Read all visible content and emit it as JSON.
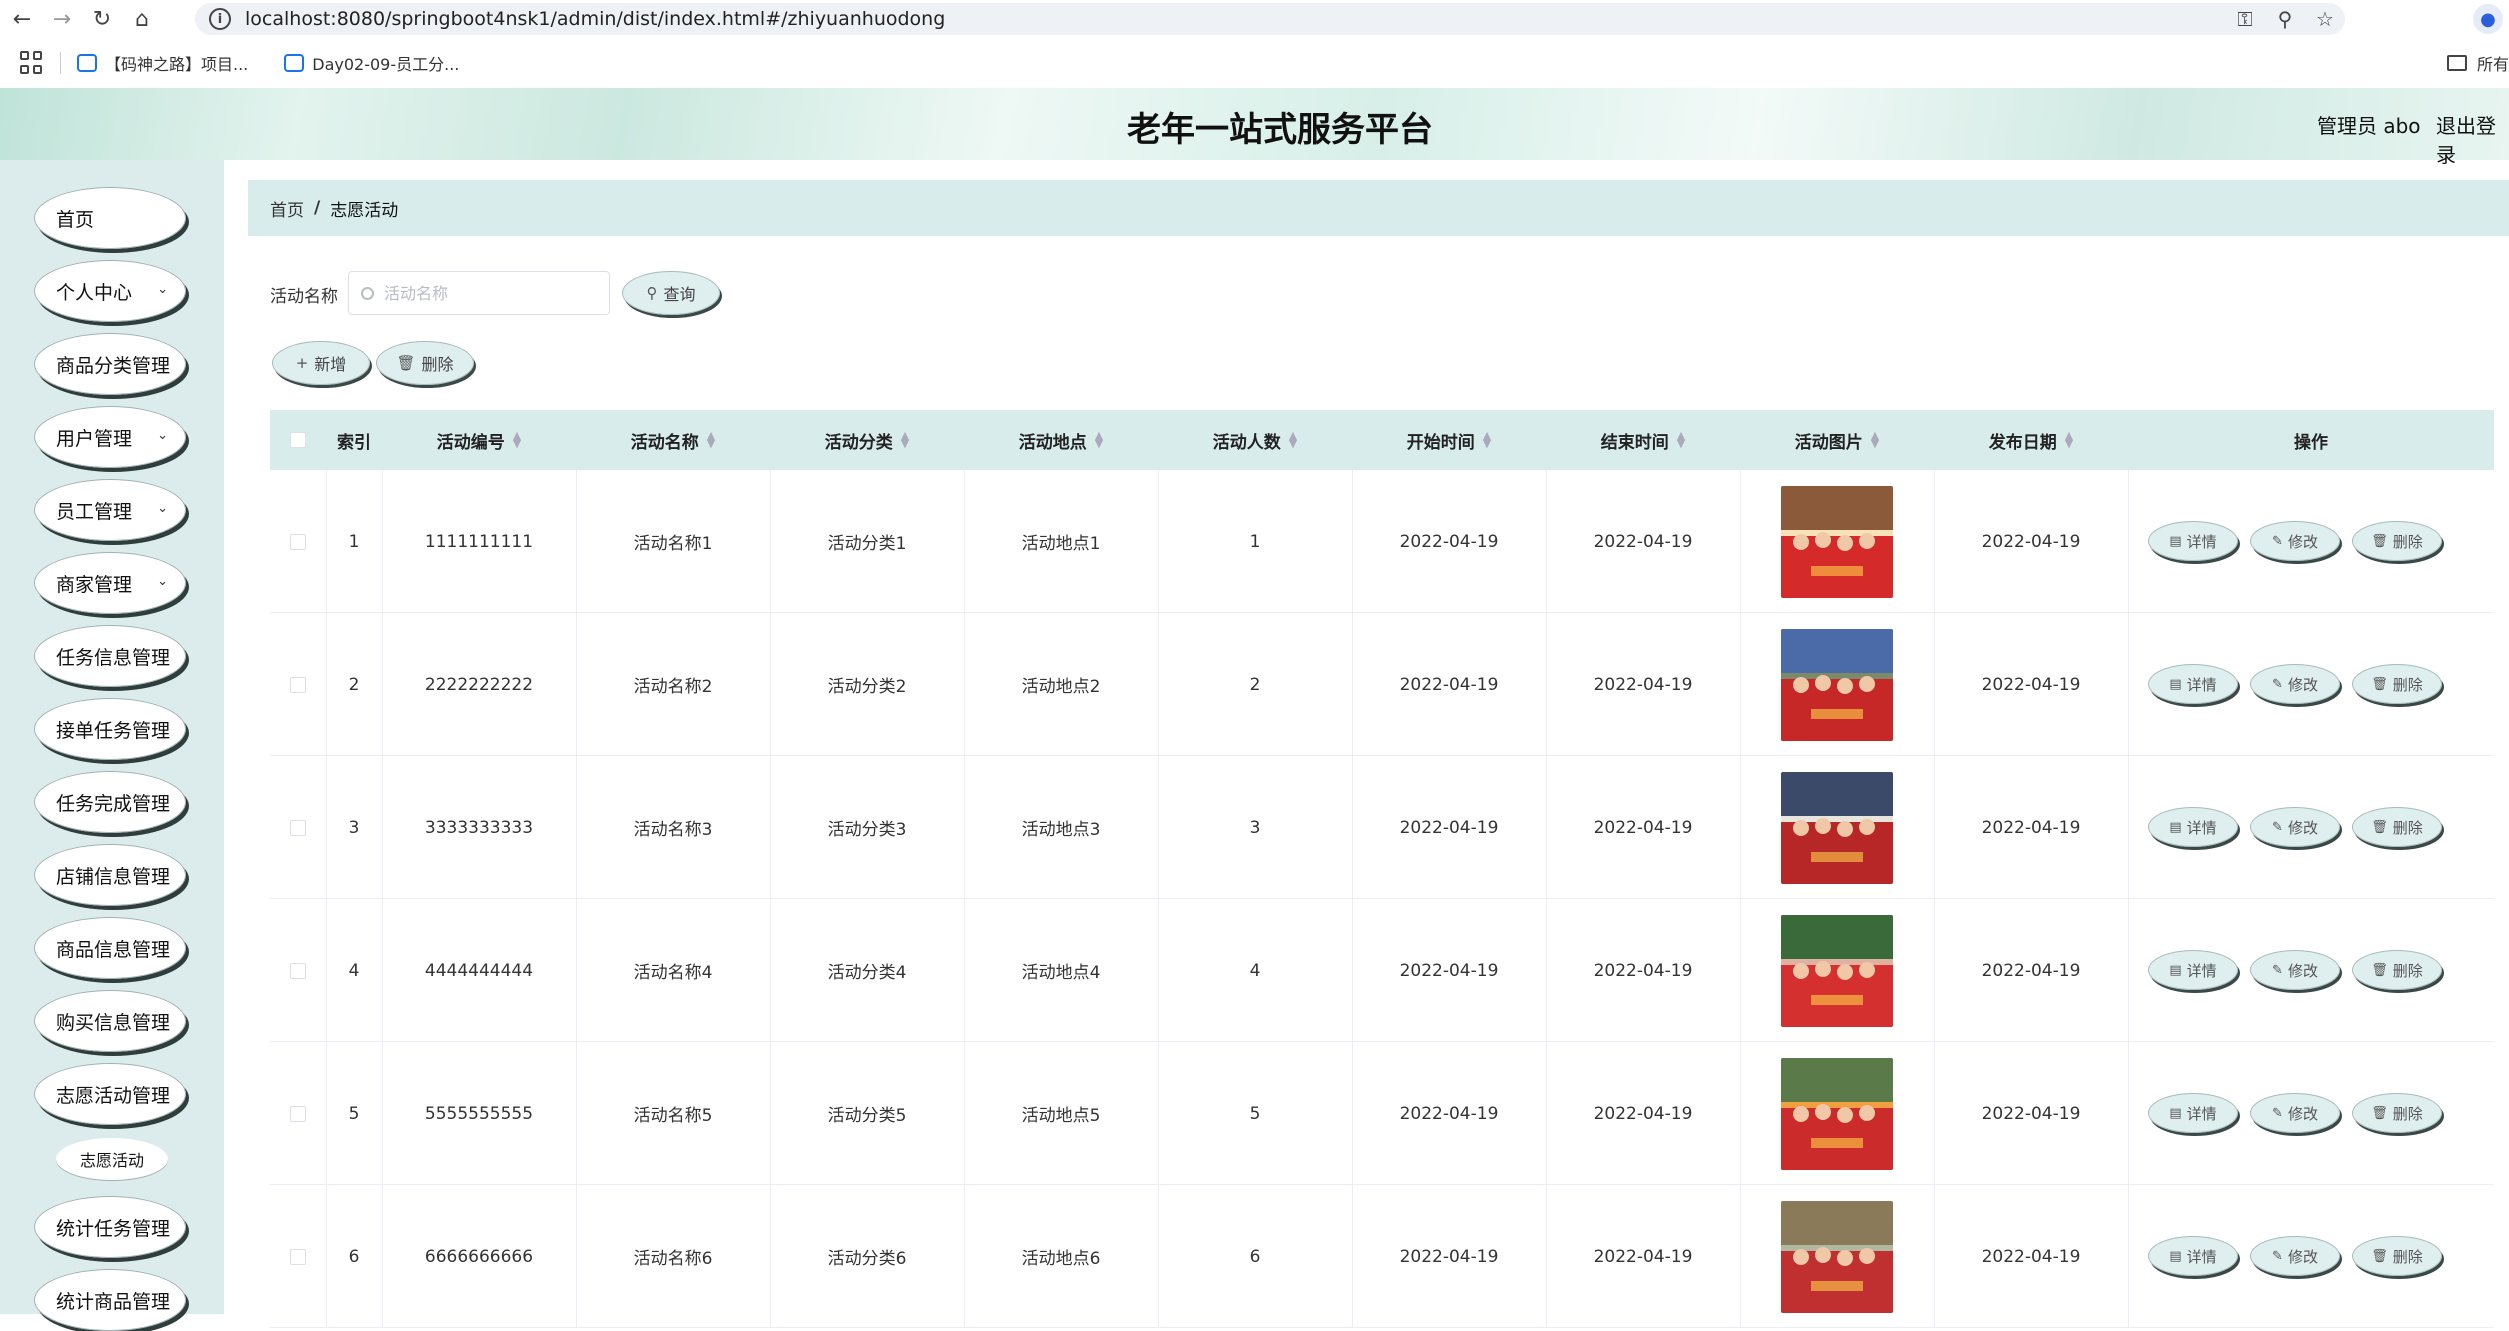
{
  "browser": {
    "url": "localhost:8080/springboot4nsk1/admin/dist/index.html#/zhiyuanhuodong",
    "bookmarks": [
      {
        "label": "【码神之路】项目..."
      },
      {
        "label": "Day02-09-员工分..."
      }
    ],
    "bookmarks_right": "所有"
  },
  "header": {
    "title": "老年一站式服务平台",
    "admin": "管理员 abo",
    "logout": "退出登录"
  },
  "sidebar": {
    "items": [
      {
        "label": "首页"
      },
      {
        "label": "个人中心"
      },
      {
        "label": "商品分类管理"
      },
      {
        "label": "用户管理"
      },
      {
        "label": "员工管理"
      },
      {
        "label": "商家管理"
      },
      {
        "label": "任务信息管理"
      },
      {
        "label": "接单任务管理"
      },
      {
        "label": "任务完成管理"
      },
      {
        "label": "店铺信息管理"
      },
      {
        "label": "商品信息管理"
      },
      {
        "label": "购买信息管理"
      },
      {
        "label": "志愿活动管理"
      },
      {
        "label": "统计任务管理"
      },
      {
        "label": "统计商品管理"
      }
    ],
    "submenu": "志愿活动"
  },
  "breadcrumb": {
    "home": "首页",
    "sep": "/",
    "current": "志愿活动"
  },
  "search": {
    "label": "活动名称",
    "placeholder": "活动名称",
    "button": "查询"
  },
  "toolbar": {
    "add": "新增",
    "delete": "删除"
  },
  "table": {
    "columns": [
      "索引",
      "活动编号",
      "活动名称",
      "活动分类",
      "活动地点",
      "活动人数",
      "开始时间",
      "结束时间",
      "活动图片",
      "发布日期",
      "操作"
    ],
    "rows": [
      {
        "index": "1",
        "code": "1111111111",
        "name": "活动名称1",
        "category": "活动分类1",
        "place": "活动地点1",
        "people": "1",
        "start": "2022-04-19",
        "end": "2022-04-19",
        "pub": "2022-04-19"
      },
      {
        "index": "2",
        "code": "2222222222",
        "name": "活动名称2",
        "category": "活动分类2",
        "place": "活动地点2",
        "people": "2",
        "start": "2022-04-19",
        "end": "2022-04-19",
        "pub": "2022-04-19"
      },
      {
        "index": "3",
        "code": "3333333333",
        "name": "活动名称3",
        "category": "活动分类3",
        "place": "活动地点3",
        "people": "3",
        "start": "2022-04-19",
        "end": "2022-04-19",
        "pub": "2022-04-19"
      },
      {
        "index": "4",
        "code": "4444444444",
        "name": "活动名称4",
        "category": "活动分类4",
        "place": "活动地点4",
        "people": "4",
        "start": "2022-04-19",
        "end": "2022-04-19",
        "pub": "2022-04-19"
      },
      {
        "index": "5",
        "code": "5555555555",
        "name": "活动名称5",
        "category": "活动分类5",
        "place": "活动地点5",
        "people": "5",
        "start": "2022-04-19",
        "end": "2022-04-19",
        "pub": "2022-04-19"
      },
      {
        "index": "6",
        "code": "6666666666",
        "name": "活动名称6",
        "category": "活动分类6",
        "place": "活动地点6",
        "people": "6",
        "start": "2022-04-19",
        "end": "2022-04-19",
        "pub": "2022-04-19"
      }
    ],
    "actions": {
      "detail": "详情",
      "edit": "修改",
      "delete": "删除"
    }
  },
  "colors": {
    "accent": "#d9ecec",
    "sidebar_bg": "#dcecec",
    "button_bg": "#dfeeee",
    "photo_red": "#d42a2a"
  }
}
